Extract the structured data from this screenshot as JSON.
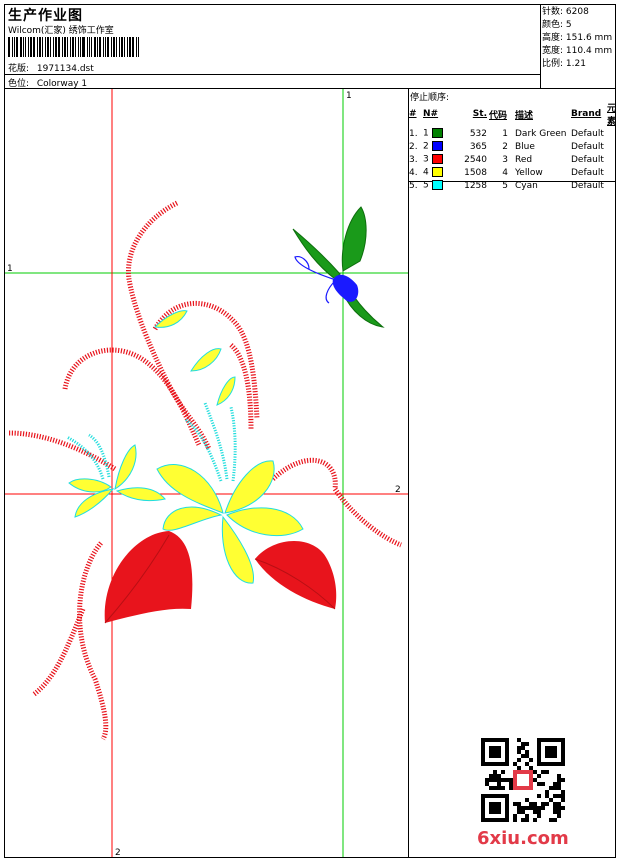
{
  "header": {
    "title": "生产作业图",
    "subtitle": "Wilcom(汇家) 绣饰工作室",
    "file_label": "花版:",
    "file_name": "1971134.dst",
    "color_label": "色位:",
    "color_name": "Colorway 1"
  },
  "stats": [
    {
      "label": "针数:",
      "value": "6208"
    },
    {
      "label": "颜色:",
      "value": "5"
    },
    {
      "label": "高度:",
      "value": "151.6 mm"
    },
    {
      "label": "宽度:",
      "value": "110.4 mm"
    },
    {
      "label": "比例:",
      "value": "1.21"
    }
  ],
  "legend": {
    "title": "停止顺序:",
    "headers": [
      "#",
      "N#",
      "St.",
      "代码",
      "描述",
      "Brand",
      "元素"
    ],
    "rows": [
      {
        "idx": "1.",
        "n": "1",
        "color": "#008000",
        "st": "532",
        "code": "1",
        "desc": "Dark Green",
        "brand": "Default"
      },
      {
        "idx": "2.",
        "n": "2",
        "color": "#0000ff",
        "st": "365",
        "code": "2",
        "desc": "Blue",
        "brand": "Default"
      },
      {
        "idx": "3.",
        "n": "3",
        "color": "#ff0000",
        "st": "2540",
        "code": "3",
        "desc": "Red",
        "brand": "Default"
      },
      {
        "idx": "4.",
        "n": "4",
        "color": "#ffff00",
        "st": "1508",
        "code": "4",
        "desc": "Yellow",
        "brand": "Default"
      },
      {
        "idx": "5.",
        "n": "5",
        "color": "#00ffff",
        "st": "1258",
        "code": "5",
        "desc": "Cyan",
        "brand": "Default"
      }
    ]
  },
  "axes": {
    "green_top": "1",
    "green_left": "1",
    "red_right": "2",
    "red_bottom": "2"
  },
  "colors": {
    "guide_red": "#ff0000",
    "guide_green": "#00cc00",
    "thread_red": "#e8141c",
    "thread_yellow": "#ffff33",
    "thread_cyan": "#22dddd",
    "thread_green": "#1a9a1a",
    "thread_blue": "#1a1aff",
    "watermark": "#e23a48"
  },
  "watermark": "6xiu.com"
}
